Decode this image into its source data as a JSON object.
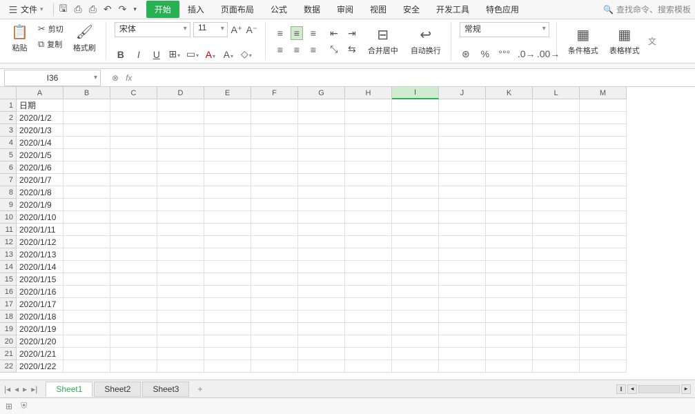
{
  "menu": {
    "file": "文件",
    "tabs": [
      "开始",
      "插入",
      "页面布局",
      "公式",
      "数据",
      "审阅",
      "视图",
      "安全",
      "开发工具",
      "特色应用"
    ],
    "active_tab": 0,
    "search": "查找命令、搜索模板"
  },
  "ribbon": {
    "paste": "粘贴",
    "cut": "剪切",
    "copy": "复制",
    "format_painter": "格式刷",
    "font_name": "宋体",
    "font_size": "11",
    "merge_center": "合并居中",
    "wrap_text": "自动换行",
    "number_format": "常规",
    "cond_format": "条件格式",
    "table_style": "表格样式"
  },
  "formula_bar": {
    "name_box": "I36",
    "formula": ""
  },
  "sheet": {
    "columns": [
      "A",
      "B",
      "C",
      "D",
      "E",
      "F",
      "G",
      "H",
      "I",
      "J",
      "K",
      "L",
      "M"
    ],
    "rows": 22,
    "active_col": "I",
    "data": {
      "A1": "日期",
      "A2": "2020/1/2",
      "A3": "2020/1/3",
      "A4": "2020/1/4",
      "A5": "2020/1/5",
      "A6": "2020/1/6",
      "A7": "2020/1/7",
      "A8": "2020/1/8",
      "A9": "2020/1/9",
      "A10": "2020/1/10",
      "A11": "2020/1/11",
      "A12": "2020/1/12",
      "A13": "2020/1/13",
      "A14": "2020/1/14",
      "A15": "2020/1/15",
      "A16": "2020/1/16",
      "A17": "2020/1/17",
      "A18": "2020/1/18",
      "A19": "2020/1/19",
      "A20": "2020/1/20",
      "A21": "2020/1/21",
      "A22": "2020/1/22"
    }
  },
  "sheet_tabs": {
    "tabs": [
      "Sheet1",
      "Sheet2",
      "Sheet3"
    ],
    "active": 0
  }
}
